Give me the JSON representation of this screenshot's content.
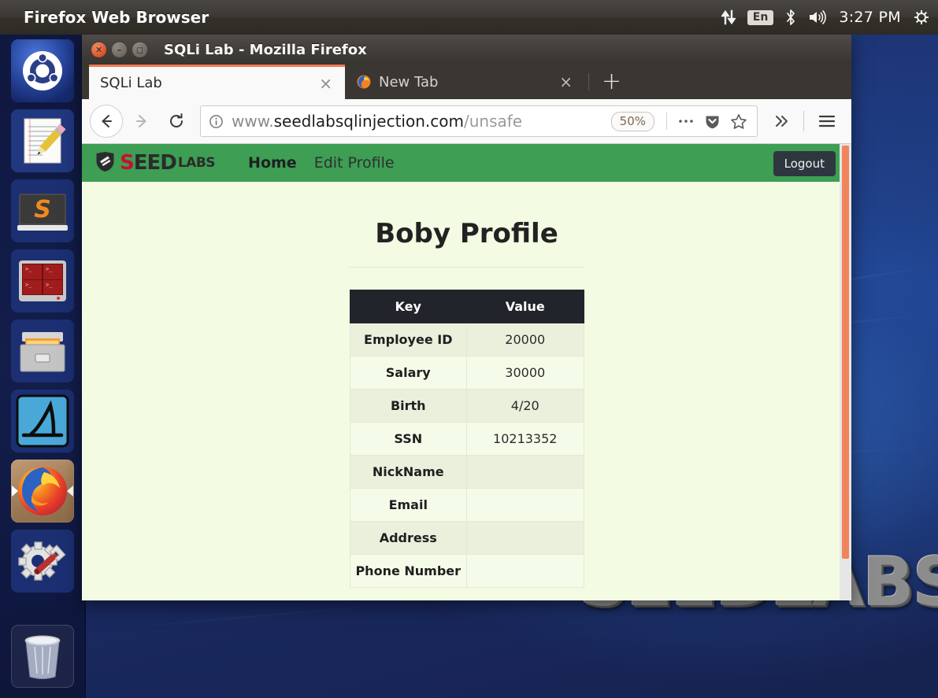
{
  "desktop": {
    "wallpaper_text": "SEEDLABS",
    "panel": {
      "app_name": "Firefox Web Browser",
      "tray": {
        "network_icon": "up-down-arrows-icon",
        "keyboard_layout": "En",
        "bluetooth_icon": "bluetooth-icon",
        "volume_icon": "volume-icon",
        "clock": "3:27 PM",
        "session_icon": "gear-power-icon"
      }
    },
    "dock": {
      "items": [
        {
          "name": "ubuntu-dash",
          "icon": "ubuntu-logo-icon",
          "running": false
        },
        {
          "name": "text-editor",
          "icon": "document-pencil-icon",
          "running": false
        },
        {
          "name": "sublime-text",
          "icon": "sublime-s-icon",
          "running": false
        },
        {
          "name": "terminal",
          "icon": "terminal-icon",
          "running": false
        },
        {
          "name": "file-manager",
          "icon": "file-cabinet-icon",
          "running": false
        },
        {
          "name": "wireshark",
          "icon": "shark-fin-icon",
          "running": false
        },
        {
          "name": "firefox",
          "icon": "firefox-icon",
          "running": true
        },
        {
          "name": "system-settings",
          "icon": "gear-wrench-icon",
          "running": false
        },
        {
          "name": "trash",
          "icon": "trash-bin-icon",
          "running": false
        }
      ]
    }
  },
  "browser": {
    "window_title": "SQLi Lab - Mozilla Firefox",
    "window_buttons": {
      "close": "close-button",
      "minimize": "minimize-button",
      "maximize": "maximize-button"
    },
    "tabs": [
      {
        "label": "SQLi Lab",
        "active": true,
        "close_label": "×",
        "favicon": "none"
      },
      {
        "label": "New Tab",
        "active": false,
        "close_label": "×",
        "favicon": "firefox-icon"
      }
    ],
    "new_tab_button": "+",
    "toolbar": {
      "back_icon": "back-arrow-icon",
      "forward_icon": "forward-arrow-icon",
      "reload_icon": "reload-icon",
      "identity_icon": "info-circle-icon",
      "url_prefix": "www.",
      "url_host": "seedlabsqlinjection.com",
      "url_path": "/unsafe",
      "url_full": "www.seedlabsqlinjection.com/unsafe",
      "zoom_level": "50%",
      "page_actions_icon": "ellipsis-icon",
      "pocket_icon": "pocket-shield-icon",
      "bookmark_icon": "star-icon",
      "overflow_icon": "double-chevron-right-icon",
      "menu_icon": "hamburger-menu-icon"
    }
  },
  "webpage": {
    "brand": {
      "shield_icon": "seed-shield-icon",
      "seed_s": "S",
      "seed_rest": "EED",
      "labs": "LABS"
    },
    "nav_links": [
      {
        "label": "Home",
        "active": true
      },
      {
        "label": "Edit Profile",
        "active": false
      }
    ],
    "logout_label": "Logout",
    "page_title": "Boby Profile",
    "table": {
      "headers": [
        "Key",
        "Value"
      ],
      "rows": [
        {
          "key": "Employee ID",
          "value": "20000"
        },
        {
          "key": "Salary",
          "value": "30000"
        },
        {
          "key": "Birth",
          "value": "4/20"
        },
        {
          "key": "SSN",
          "value": "10213352"
        },
        {
          "key": "NickName",
          "value": ""
        },
        {
          "key": "Email",
          "value": ""
        },
        {
          "key": "Address",
          "value": ""
        },
        {
          "key": "Phone Number",
          "value": ""
        }
      ]
    }
  },
  "colors": {
    "panel_bg": "#3c3833",
    "nav_green": "#3d9e54",
    "page_bg": "#f3fbe3",
    "table_header_bg": "#21252b",
    "logout_bg": "#2f3640",
    "scrollbar_thumb": "#f0845c",
    "tab_accent": "#ef7a52",
    "seed_red": "#c8102e"
  }
}
